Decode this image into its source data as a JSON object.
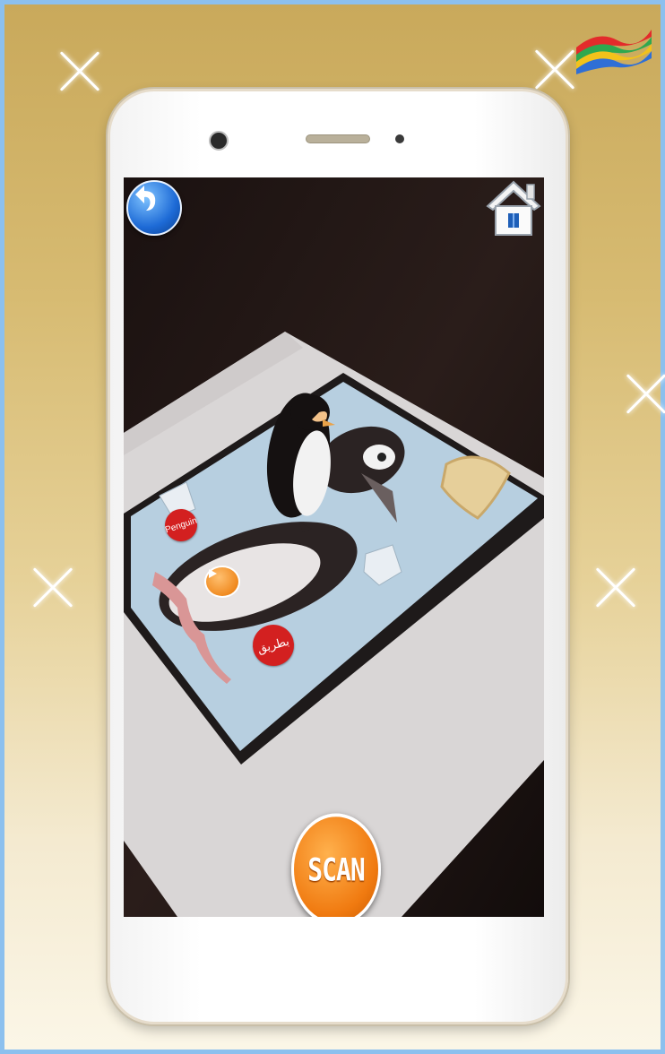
{
  "app": {
    "labels": {
      "english_name": "Penguin",
      "arabic_name": "بطريق"
    },
    "buttons": {
      "scan_label": "SCAN"
    },
    "icons": {
      "back": "back-arrow-icon",
      "home": "home-icon",
      "play": "play-icon",
      "logo": "rainbow-flag-logo"
    },
    "colors": {
      "tag_red": "#d32020",
      "scan_orange": "#f07a10",
      "back_blue": "#1d6ad6",
      "frame_border": "#8cc0ee"
    }
  }
}
